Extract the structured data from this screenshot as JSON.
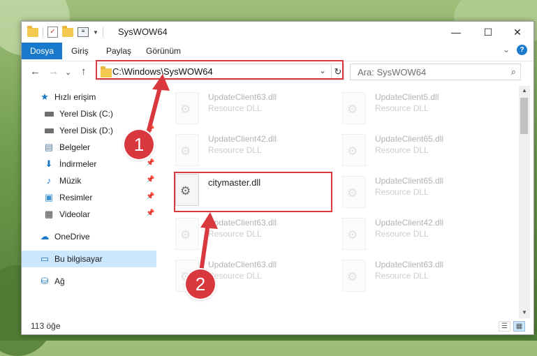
{
  "window": {
    "title": "SysWOW64",
    "minimize_glyph": "—",
    "maximize_glyph": "☐",
    "close_glyph": "✕"
  },
  "ribbon": {
    "tabs": [
      "Dosya",
      "Giriş",
      "Paylaş",
      "Görünüm"
    ],
    "expand_glyph": "⌄",
    "help_glyph": "?"
  },
  "nav": {
    "back_glyph": "←",
    "forward_glyph": "→",
    "recent_glyph": "⌄",
    "up_glyph": "↑",
    "address": "C:\\Windows\\SysWOW64",
    "address_dropdown_glyph": "⌄",
    "refresh_glyph": "↻",
    "search_placeholder": "Ara: SysWOW64",
    "search_glyph": "⌕"
  },
  "sidebar": {
    "items": [
      {
        "label": "Hızlı erişim",
        "icon": "star-icon"
      },
      {
        "label": "Yerel Disk (C:)",
        "icon": "drive-icon"
      },
      {
        "label": "Yerel Disk (D:)",
        "icon": "drive-icon"
      },
      {
        "label": "Belgeler",
        "icon": "documents-icon"
      },
      {
        "label": "İndirmeler",
        "icon": "download-icon"
      },
      {
        "label": "Müzik",
        "icon": "music-icon"
      },
      {
        "label": "Resimler",
        "icon": "pictures-icon"
      },
      {
        "label": "Videolar",
        "icon": "videos-icon"
      },
      {
        "label": "OneDrive",
        "icon": "cloud-icon"
      },
      {
        "label": "Bu bilgisayar",
        "icon": "computer-icon"
      },
      {
        "label": "Ağ",
        "icon": "network-icon"
      }
    ],
    "pin_glyph": "📌"
  },
  "files": [
    {
      "name": "UpdateClient63.dll",
      "type": "Resource DLL"
    },
    {
      "name": "UpdateClient5.dll",
      "type": "Resource DLL"
    },
    {
      "name": "UpdateClient42.dll",
      "type": "Resource DLL"
    },
    {
      "name": "UpdateClient65.dll",
      "type": "Resource DLL"
    },
    {
      "name": "citymaster.dll",
      "type": ""
    },
    {
      "name": "UpdateClient65.dll",
      "type": "Resource DLL"
    },
    {
      "name": "UpdateClient63.dll",
      "type": "Resource DLL"
    },
    {
      "name": "UpdateClient42.dll",
      "type": "Resource DLL"
    },
    {
      "name": "UpdateClient63.dll",
      "type": "Resource DLL"
    },
    {
      "name": "UpdateClient63.dll",
      "type": "Resource DLL"
    }
  ],
  "status": {
    "item_count": "113 öğe"
  },
  "annotations": {
    "step1": "1",
    "step2": "2",
    "color": "#d9383f"
  }
}
